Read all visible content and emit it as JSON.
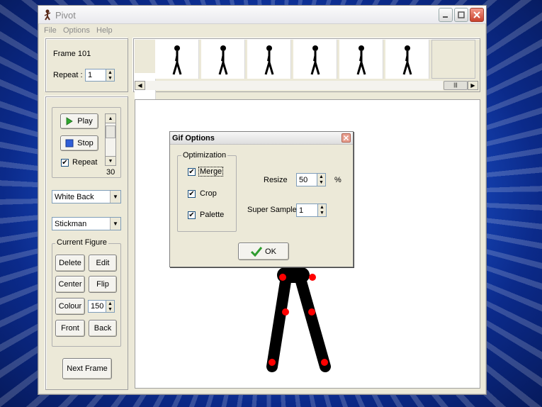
{
  "window": {
    "title": "Pivot",
    "menu": [
      "File",
      "Options",
      "Help"
    ]
  },
  "frame_panel": {
    "frame_label": "Frame 101",
    "repeat_label": "Repeat :",
    "repeat_value": "1"
  },
  "playback": {
    "play_label": "Play",
    "stop_label": "Stop",
    "repeat_label": "Repeat",
    "repeat_checked": true,
    "speed_value": "30"
  },
  "background_select": {
    "value": "White Back"
  },
  "figure_select": {
    "value": "Stickman"
  },
  "current_figure": {
    "legend": "Current Figure",
    "delete_label": "Delete",
    "edit_label": "Edit",
    "center_label": "Center",
    "flip_label": "Flip",
    "colour_label": "Colour",
    "colour_value": "150",
    "front_label": "Front",
    "back_label": "Back"
  },
  "next_frame_label": "Next Frame",
  "gif_dialog": {
    "title": "Gif Options",
    "optimization_legend": "Optimization",
    "merge_label": "Merge",
    "crop_label": "Crop",
    "palette_label": "Palette",
    "resize_label": "Resize",
    "resize_value": "50",
    "percent_label": "%",
    "super_sample_label": "Super Sample",
    "super_sample_value": "1",
    "ok_label": "OK"
  },
  "colors": {
    "figure": "#000000",
    "joint": "#ff0000",
    "play_icon": "#2fa82f",
    "stop_icon": "#2f5ed8",
    "ok_check": "#2f9c2f"
  }
}
